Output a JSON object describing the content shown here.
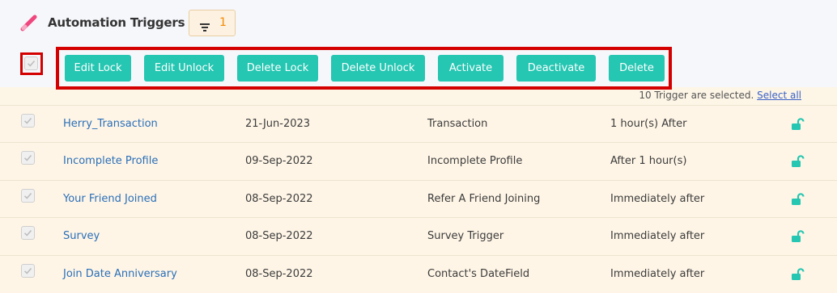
{
  "header": {
    "title": "Automation Triggers",
    "title_icon": "pencil-icon",
    "filter": {
      "icon": "filter-icon",
      "count": "1"
    }
  },
  "actions": {
    "buttons": [
      {
        "label": "Edit Lock"
      },
      {
        "label": "Edit Unlock"
      },
      {
        "label": "Delete Lock"
      },
      {
        "label": "Delete Unlock"
      },
      {
        "label": "Activate"
      },
      {
        "label": "Deactivate"
      },
      {
        "label": "Delete"
      }
    ]
  },
  "selection": {
    "text": "10 Trigger are selected.",
    "link": "Select all"
  },
  "table": {
    "rows": [
      {
        "name": "Herry_Transaction",
        "date": "21-Jun-2023",
        "type": "Transaction",
        "timing": "1 hour(s) After",
        "checked": true,
        "lock_icon": "unlock-icon"
      },
      {
        "name": "Incomplete Profile",
        "date": "09-Sep-2022",
        "type": "Incomplete Profile",
        "timing": "After 1 hour(s)",
        "checked": true,
        "lock_icon": "unlock-icon"
      },
      {
        "name": "Your Friend Joined",
        "date": "08-Sep-2022",
        "type": "Refer A Friend Joining",
        "timing": "Immediately after",
        "checked": true,
        "lock_icon": "unlock-icon"
      },
      {
        "name": "Survey",
        "date": "08-Sep-2022",
        "type": "Survey Trigger",
        "timing": "Immediately after",
        "checked": true,
        "lock_icon": "unlock-icon"
      },
      {
        "name": "Join Date Anniversary",
        "date": "08-Sep-2022",
        "type": "Contact's DateField",
        "timing": "Immediately after",
        "checked": true,
        "lock_icon": "unlock-icon"
      }
    ]
  },
  "colors": {
    "accent": "#25c6b2",
    "highlight_border": "#d40000",
    "link": "#2a6fb8",
    "filter_count": "#f28a00",
    "row_background": "#fef5e6"
  }
}
